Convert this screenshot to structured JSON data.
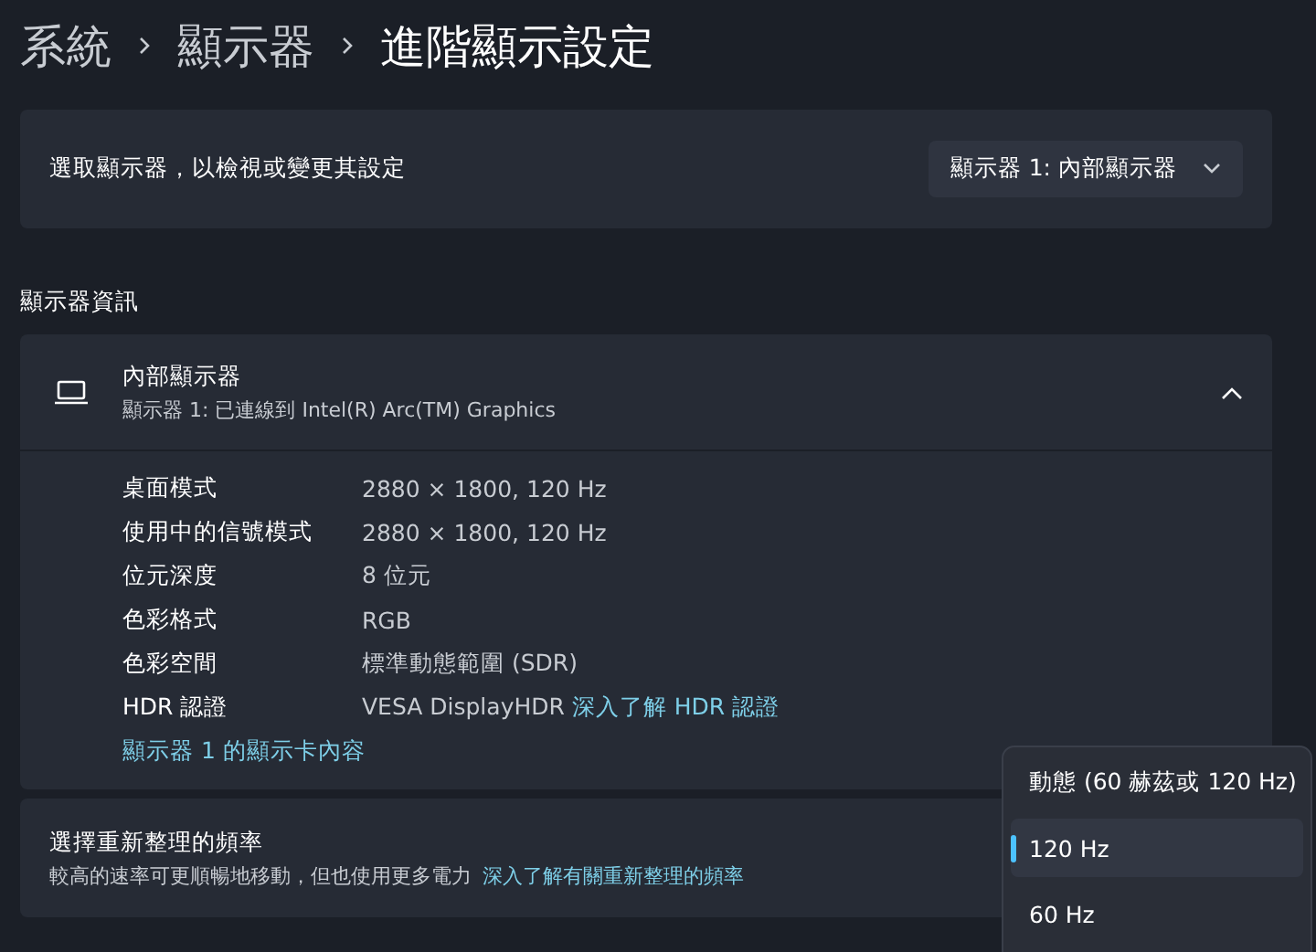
{
  "breadcrumb": [
    {
      "label": "系統",
      "current": false
    },
    {
      "label": "顯示器",
      "current": false
    },
    {
      "label": "進階顯示設定",
      "current": true
    }
  ],
  "display_select": {
    "label": "選取顯示器，以檢視或變更其設定",
    "value": "顯示器 1: 內部顯示器"
  },
  "section_title": "顯示器資訊",
  "display_info": {
    "title": "內部顯示器",
    "subtitle": "顯示器 1: 已連線到 Intel(R) Arc(TM) Graphics",
    "expanded": true,
    "rows": [
      {
        "label": "桌面模式",
        "value": "2880 × 1800, 120 Hz"
      },
      {
        "label": "使用中的信號模式",
        "value": "2880 × 1800, 120 Hz"
      },
      {
        "label": "位元深度",
        "value": "8 位元"
      },
      {
        "label": "色彩格式",
        "value": "RGB"
      },
      {
        "label": "色彩空間",
        "value": "標準動態範圍 (SDR)"
      },
      {
        "label": "HDR 認證",
        "value": "VESA DisplayHDR",
        "link": "深入了解 HDR 認證"
      }
    ],
    "adapter_link": "顯示器 1 的顯示卡內容"
  },
  "refresh_rate": {
    "title": "選擇重新整理的頻率",
    "description": "較高的速率可更順暢地移動，但也使用更多電力",
    "link": "深入了解有關重新整理的頻率",
    "options": [
      {
        "label": "動態 (60 赫茲或 120 Hz)",
        "selected": false
      },
      {
        "label": "120 Hz",
        "selected": true
      },
      {
        "label": "60 Hz",
        "selected": false
      }
    ]
  }
}
